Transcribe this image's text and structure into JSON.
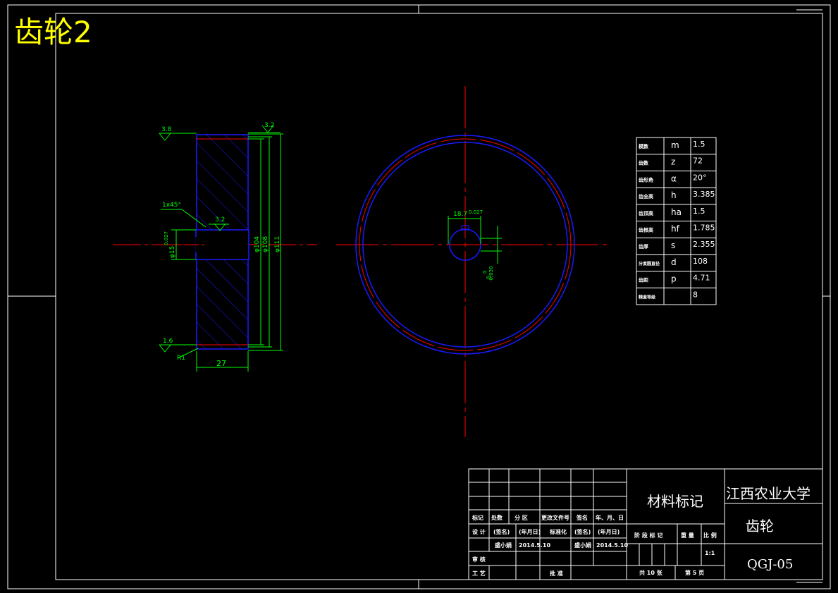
{
  "drawing_title": "齿轮2",
  "section_view": {
    "roughness": [
      "3.8",
      "1.6",
      "3.2",
      "3.2"
    ],
    "chamfer": "1x45°",
    "radius": "R1",
    "dim_width": "27",
    "dim_bore": "φ15",
    "dim_bore_tol": "0.027",
    "dim_dia1": "φ104",
    "dim_dia2": "φ108",
    "dim_dia3": "φ111"
  },
  "front_view": {
    "key_width": "18.7",
    "key_tol": "0.027",
    "keyway_width": "5",
    "keyway_tol1": "0",
    "keyway_tol2": "-0.030"
  },
  "params_table": [
    {
      "label": "模数",
      "symbol": "m",
      "value": "1.5"
    },
    {
      "label": "齿数",
      "symbol": "z",
      "value": "72"
    },
    {
      "label": "齿形角",
      "symbol": "α",
      "value": "20°"
    },
    {
      "label": "齿全高",
      "symbol": "h",
      "value": "3.385"
    },
    {
      "label": "齿顶高",
      "symbol": "ha",
      "value": "1.5"
    },
    {
      "label": "齿根高",
      "symbol": "hf",
      "value": "1.785"
    },
    {
      "label": "齿厚",
      "symbol": "s",
      "value": "2.355"
    },
    {
      "label": "分度圆直径",
      "symbol": "d",
      "value": "108"
    },
    {
      "label": "齿距",
      "symbol": "p",
      "value": "4.71"
    },
    {
      "label": "精度等级",
      "symbol": "",
      "value": "8"
    }
  ],
  "title_block": {
    "material": "材料标记",
    "university": "江西农业大学",
    "part_name": "齿轮",
    "drawing_no": "QGJ-05",
    "header_row": [
      "标记",
      "处数",
      "分 区",
      "更改文件号",
      "签名",
      "年、月、日"
    ],
    "design_row": [
      "设 计",
      "(签名)",
      "(年月日)",
      "标准化",
      "(签名)",
      "(年月日)"
    ],
    "date_row": [
      "",
      "盛小娟",
      "2014.5.10",
      "",
      "盛小娟",
      "2014.5.10"
    ],
    "review": "审 核",
    "process": "工 艺",
    "approve": "批 准",
    "stage_label": "阶 段 标 记",
    "weight_label": "重 量",
    "scale_label": "比 例",
    "scale": "1:1",
    "sheets_total": "共 10 张",
    "sheet_no": "第 5 页"
  },
  "colors": {
    "frame": "#ffffff",
    "section_outline": "#0000ff",
    "hatch": "#0000ff",
    "dimension": "#00ff00",
    "centerline": "#ff0000",
    "title": "#ffff00",
    "table_text": "#ffffff"
  }
}
